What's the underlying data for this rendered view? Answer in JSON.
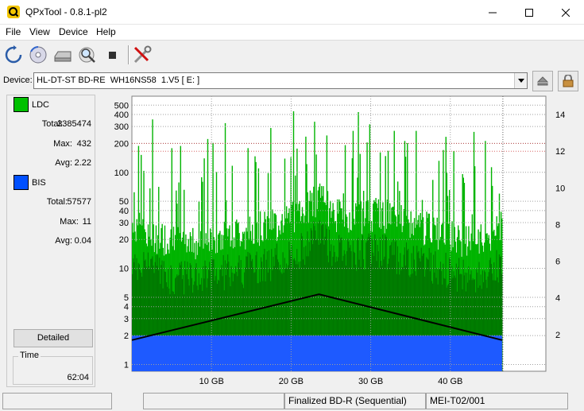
{
  "window": {
    "title": "QPxTool - 0.8.1-pl2"
  },
  "menu": {
    "items": [
      "File",
      "View",
      "Device",
      "Help"
    ]
  },
  "toolbar": {
    "icons": [
      "refresh-icon",
      "disc-scan-icon",
      "drive-icon",
      "magnifier-icon",
      "stop-icon",
      "settings-tools-icon"
    ]
  },
  "device": {
    "label": "Device:",
    "selected": "HL-DT-ST BD-RE  WH16NS58  1.V5 [ E: ]"
  },
  "legend": {
    "ldc": {
      "name": "LDC",
      "color": "#00c000",
      "total_label": "Total:",
      "total": "3385474",
      "max_label": "Max:",
      "max": "432",
      "avg_label": "Avg:",
      "avg": "2.22"
    },
    "bis": {
      "name": "BIS",
      "color": "#0050ff",
      "total_label": "Total:",
      "total": "57577",
      "max_label": "Max:",
      "max": "11",
      "avg_label": "Avg:",
      "avg": "0.04"
    }
  },
  "buttons": {
    "detailed": "Detailed"
  },
  "time": {
    "caption": "Time",
    "value": "62:04"
  },
  "status": {
    "cell1": "",
    "cell2": "",
    "media": "Finalized BD-R (Sequential)",
    "media_id": "MEI-T02/001"
  },
  "chart_data": {
    "type": "area",
    "x_unit": "GB",
    "xlim": [
      0,
      50
    ],
    "x_ticks": [
      "10 GB",
      "20 GB",
      "30 GB",
      "40 GB"
    ],
    "x_tick_values": [
      10,
      20,
      30,
      40
    ],
    "y_left_scale": "log",
    "y_left_ticks": [
      "1",
      "2",
      "3",
      "4",
      "5",
      "10",
      "20",
      "30",
      "40",
      "50",
      "100",
      "200",
      "300",
      "400",
      "500"
    ],
    "y_left_tick_values": [
      1,
      2,
      3,
      4,
      5,
      10,
      20,
      30,
      40,
      50,
      100,
      200,
      300,
      400,
      500
    ],
    "y_right_ticks": [
      "2",
      "4",
      "6",
      "8",
      "10",
      "12",
      "14"
    ],
    "y_right_tick_values": [
      2,
      4,
      6,
      8,
      10,
      12,
      14
    ],
    "ylim_right": [
      0,
      15
    ],
    "colors": {
      "background": "#ffffff",
      "grid": "#a0a0a0",
      "ldc": "#00b400",
      "ldc_dark": "#006400",
      "bis": "#1e5aff",
      "speed": "#000000",
      "threshold": "#c00000"
    },
    "series": [
      {
        "name": "LDC",
        "x": [
          0,
          2,
          4,
          6,
          8,
          10,
          12,
          14,
          16,
          18,
          20,
          22,
          23.5,
          25,
          27,
          29,
          31,
          33,
          35,
          37,
          39,
          41,
          43,
          45,
          46.5
        ],
        "y": [
          30,
          25,
          22,
          20,
          20,
          22,
          24,
          25,
          28,
          30,
          35,
          45,
          60,
          40,
          35,
          38,
          40,
          35,
          30,
          28,
          25,
          22,
          20,
          22,
          30
        ]
      },
      {
        "name": "BIS",
        "x": [
          0,
          10,
          20,
          23.5,
          30,
          40,
          46.5
        ],
        "y": [
          2,
          2,
          2,
          2,
          2,
          2,
          2
        ]
      },
      {
        "x": [
          0,
          23.5,
          46.5
        ],
        "y": [
          1.7,
          4.2,
          1.7
        ]
      }
    ]
  }
}
